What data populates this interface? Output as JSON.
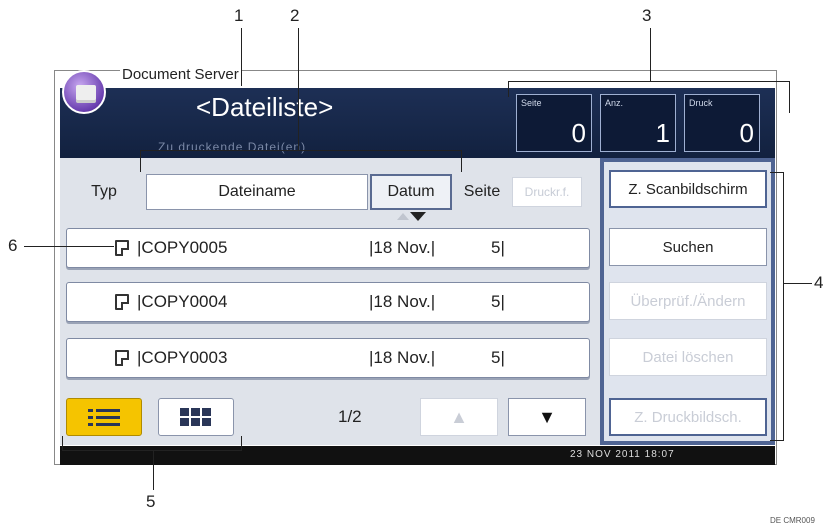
{
  "app": {
    "title": "Document Server"
  },
  "header": {
    "list_title": "<Dateiliste>",
    "subtitle": "Zu druckende Datei(en)",
    "counters": [
      {
        "label": "Seite",
        "value": "0"
      },
      {
        "label": "Anz.",
        "value": "1"
      },
      {
        "label": "Druck",
        "value": "0"
      }
    ]
  },
  "columns": {
    "type": "Typ",
    "name": "Dateiname",
    "date": "Datum",
    "page": "Seite",
    "print_order": "Druckr.f."
  },
  "files": [
    {
      "name": "COPY0005",
      "date": "18 Nov.",
      "pages": "5"
    },
    {
      "name": "COPY0004",
      "date": "18 Nov.",
      "pages": "5"
    },
    {
      "name": "COPY0003",
      "date": "18 Nov.",
      "pages": "5"
    }
  ],
  "right_buttons": {
    "scan_screen": "Z. Scanbildschirm",
    "search": "Suchen",
    "check_change": "Überprüf./Ändern",
    "delete_file": "Datei löschen",
    "print_screen": "Z. Druckbildsch."
  },
  "pagination": {
    "current": "1/2",
    "up": "▲",
    "down": "▼"
  },
  "view_icons": {
    "list": "list-view-icon",
    "grid": "grid-view-icon"
  },
  "status": {
    "datetime": "23 NOV 2011 18:07"
  },
  "callouts": [
    "1",
    "2",
    "3",
    "4",
    "5",
    "6"
  ],
  "footnote": "DE CMR009"
}
